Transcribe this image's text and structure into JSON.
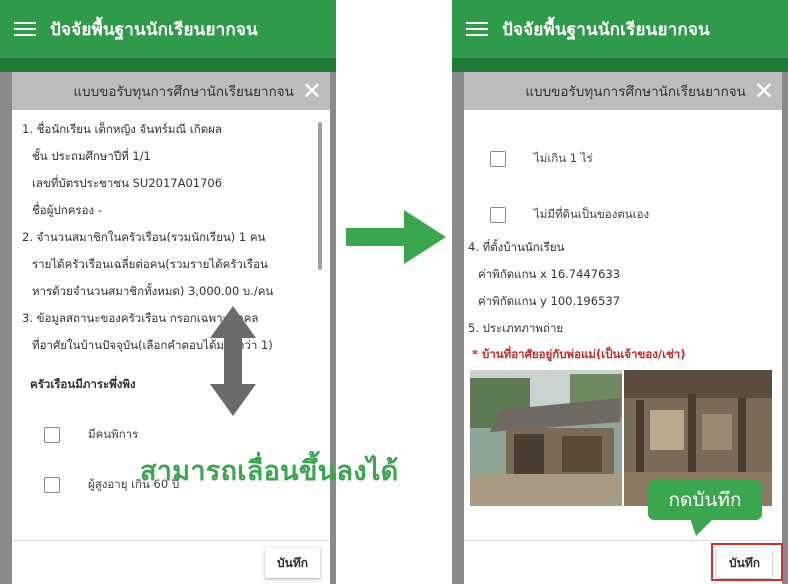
{
  "app": {
    "title": "ปัจจัยพื้นฐานนักเรียนยากจน"
  },
  "dialog": {
    "title": "แบบขอรับทุนการศึกษานักเรียนยากจน",
    "close_icon": "close-icon",
    "save_label": "บันทึก"
  },
  "left_form": {
    "lines": [
      "1. ชื่อนักเรียน เด็กหญิง จันทร์มณี เกิดผล",
      "ชั้น ประถมศึกษาปีที่ 1/1",
      "เลขที่บัตรประชาชน SU2017A01706",
      "ชื่อผู้ปกครอง -",
      "2. จำนวนสมาชิกในครัวเรือน(รวมนักเรียน) 1 คน",
      "รายได้ครัวเรือนเฉลี่ยต่อคน(รวมรายได้ครัวเรือน",
      "หารด้วยจำนวนสมาชิกทั้งหมด) 3,000.00 บ./คน",
      "3. ข้อมูลสถานะของครัวเรือน กรอกเฉพาะบุคคล",
      "ที่อาศัยในบ้านปัจจุบัน(เลือกคำตอบได้มากกว่า 1)"
    ],
    "subheading": "ครัวเรือนมีภาระพึ่งพิง",
    "checkboxes": [
      {
        "label": "มีคนพิการ",
        "checked": false
      },
      {
        "label": "ผู้สูงอายุ เกิน 60 ปี",
        "checked": false
      }
    ]
  },
  "right_form": {
    "checkboxes": [
      {
        "label": "ไม่เกิน 1 ไร่",
        "checked": false
      },
      {
        "label": "ไม่มีที่ดินเป็นของตนเอง",
        "checked": false
      }
    ],
    "section4_title": "4. ที่ตั้งบ้านนักเรียน",
    "latitude": "ค่าพิกัดแกน x 16.7447633",
    "longitude": "ค่าพิกัดแกน y 100.196537",
    "section5_title": "5. ประเภทภาพถ่าย",
    "photo_caption": "* บ้านที่อาศัยอยู่กับพ่อแม่(เป็นเจ้าของ/เช่า)"
  },
  "annotations": {
    "scroll_caption": "สามารถเลื่อนขึ้นลงได้",
    "callout_text": "กดบันทึก"
  },
  "colors": {
    "appbar": "#2e9a4a",
    "dim_overlay": "#8a8a8a",
    "annotation_green": "#3aa64e",
    "highlight_red": "#d32f2f",
    "caption_red": "#c62828"
  }
}
